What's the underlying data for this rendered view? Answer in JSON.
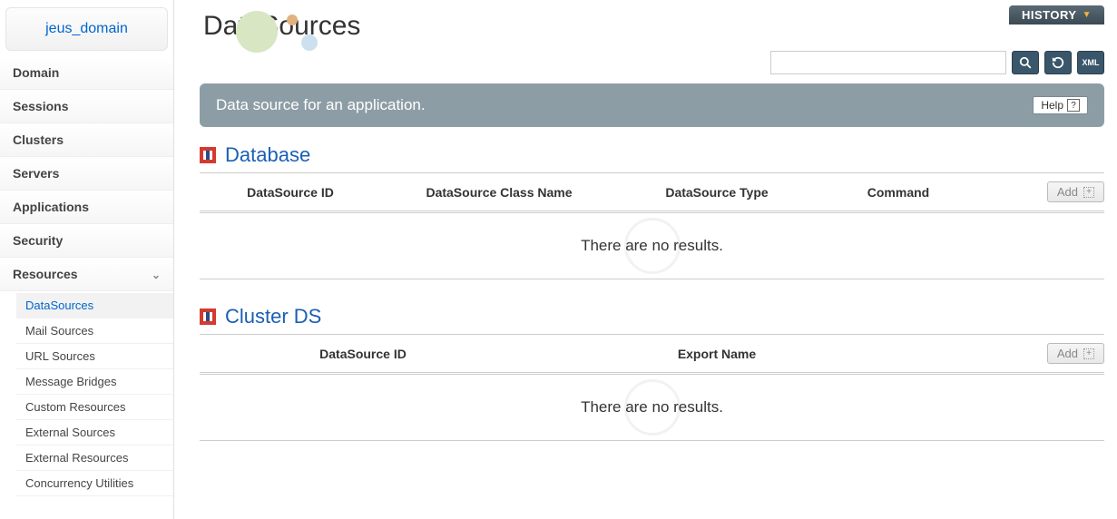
{
  "domain_name": "jeus_domain",
  "history_label": "HISTORY",
  "menu": {
    "items": [
      {
        "label": "Domain"
      },
      {
        "label": "Sessions"
      },
      {
        "label": "Clusters"
      },
      {
        "label": "Servers"
      },
      {
        "label": "Applications"
      },
      {
        "label": "Security"
      },
      {
        "label": "Resources",
        "expanded": true
      }
    ],
    "resources_sub": [
      {
        "label": "DataSources",
        "active": true
      },
      {
        "label": "Mail Sources"
      },
      {
        "label": "URL Sources"
      },
      {
        "label": "Message Bridges"
      },
      {
        "label": "Custom Resources"
      },
      {
        "label": "External Sources"
      },
      {
        "label": "External Resources"
      },
      {
        "label": "Concurrency Utilities"
      }
    ]
  },
  "page": {
    "title": "DataSources",
    "description": "Data source for an application.",
    "help_label": "Help"
  },
  "search": {
    "placeholder": ""
  },
  "tool_icons": {
    "search": "search",
    "refresh": "refresh",
    "xml": "XML"
  },
  "sections": {
    "database": {
      "title": "Database",
      "columns": [
        "DataSource ID",
        "DataSource Class Name",
        "DataSource Type",
        "Command"
      ],
      "add_label": "Add",
      "empty_text": "There are no results."
    },
    "cluster": {
      "title": "Cluster DS",
      "columns": [
        "DataSource ID",
        "Export Name"
      ],
      "add_label": "Add",
      "empty_text": "There are no results."
    }
  }
}
